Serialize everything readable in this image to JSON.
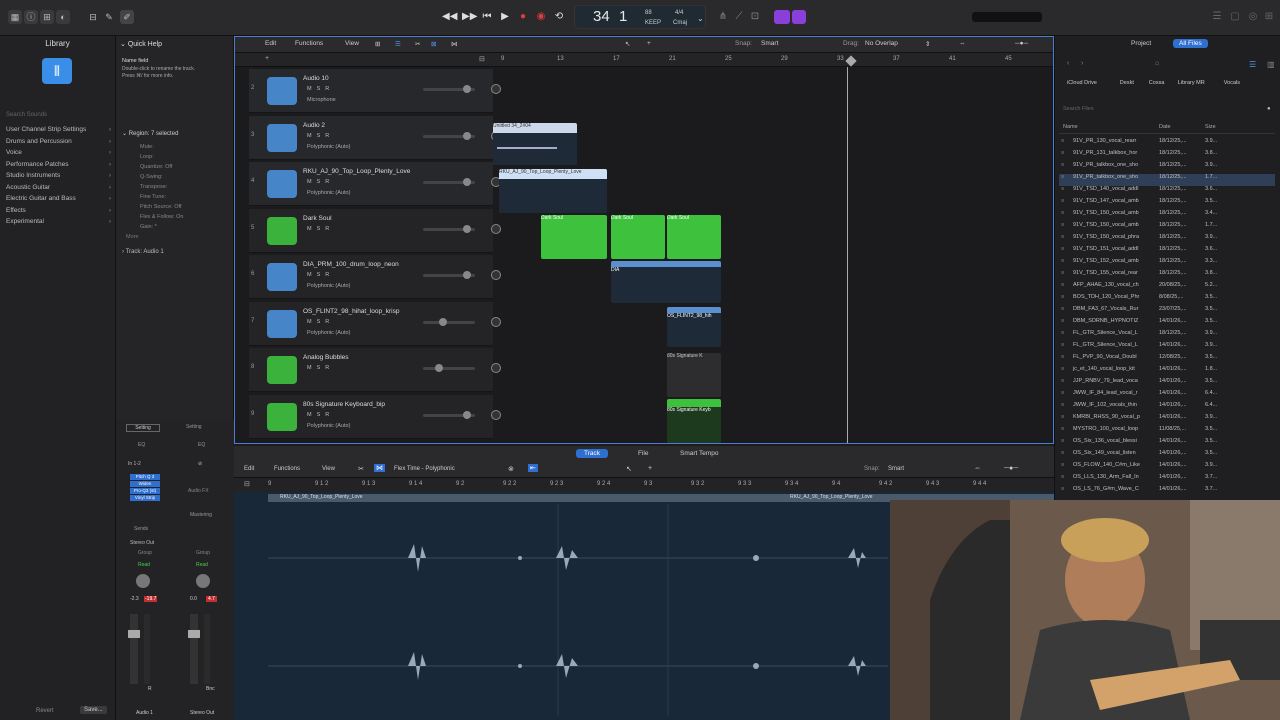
{
  "transport": {
    "position_bar": "34",
    "position_beat": "1",
    "tempo": "88",
    "tempo_label": "KEEP",
    "signature": "4/4",
    "key": "Cmaj"
  },
  "library": {
    "title": "Library",
    "search_placeholder": "Search Sounds",
    "items": [
      "User Channel Strip Settings",
      "Drums and Percussion",
      "Voice",
      "Performance Patches",
      "Studio Instruments",
      "Acoustic Guitar",
      "Electric Guitar and Bass",
      "Effects",
      "Experimental"
    ],
    "revert": "Revert",
    "save": "Save..."
  },
  "quick_help": {
    "title": "Quick Help",
    "name_field": "Name field",
    "help_text_1": "Double-click to rename the track.",
    "help_text_2": "Press ⌘/ for more info.",
    "region_label": "Region: 7 selected",
    "rows": [
      "Mute:",
      "Loop:",
      "Quantize: Off",
      "Q-Swing:",
      "Transpose:",
      "Fine Tune:",
      "Pitch Source: Off",
      "Flex & Follow: On",
      "Gain: *"
    ],
    "more": "More",
    "track_label": "Track: Audio 1"
  },
  "tracks_toolbar": {
    "edit": "Edit",
    "functions": "Functions",
    "view": "View",
    "snap_label": "Snap:",
    "snap_value": "Smart",
    "drag_label": "Drag:",
    "drag_value": "No Overlap"
  },
  "ruler": [
    "9",
    "13",
    "17",
    "21",
    "25",
    "29",
    "33",
    "37",
    "41",
    "45"
  ],
  "tracks": [
    {
      "num": "2",
      "name": "Audio 10",
      "sub": "Microphone",
      "color": "#4a90d9",
      "icon": "waveform-icon"
    },
    {
      "num": "3",
      "name": "Audio 2",
      "sub": "Polyphonic (Auto)",
      "color": "#4a90d9",
      "icon": "waveform-icon"
    },
    {
      "num": "4",
      "name": "RKU_AJ_90_Top_Loop_Plenty_Love",
      "sub": "Polyphonic (Auto)",
      "color": "#4a90d9",
      "icon": "waveform-icon"
    },
    {
      "num": "5",
      "name": "Dark Soul",
      "sub": "",
      "color": "#3ec23e",
      "icon": "guitar-icon"
    },
    {
      "num": "6",
      "name": "DIA_PRM_100_drum_loop_neon",
      "sub": "Polyphonic (Auto)",
      "color": "#4a90d9",
      "icon": "drumsticks-icon"
    },
    {
      "num": "7",
      "name": "OS_FLINT2_98_hihat_loop_krisp",
      "sub": "Polyphonic (Auto)",
      "color": "#4a90d9",
      "icon": "cymbal-icon"
    },
    {
      "num": "8",
      "name": "Analog Bubbles",
      "sub": "",
      "color": "#3ec23e",
      "icon": "synth-icon"
    },
    {
      "num": "9",
      "name": "80s Signature Keyboard_bip",
      "sub": "Polyphonic (Auto)",
      "color": "#3ec23e",
      "icon": "synth-icon"
    }
  ],
  "regions": {
    "untitled": "Untitled 34_2#04",
    "rku": "RKU_AJ_90_Top_Loop_Plenty_Love",
    "dark_soul": "Dark Soul",
    "dia": "DIA",
    "os_flint": "OS_FLINT2_98_hih",
    "sig": "80s Signature K",
    "sig2": "80s Signature Keyb"
  },
  "browser": {
    "tab_project": "Project",
    "tab_all": "All Files",
    "path": [
      "iCloud Drive",
      "Deskt",
      "Cossa",
      "Library MR",
      "Vocals"
    ],
    "search_placeholder": "Search Files",
    "col_name": "Name",
    "col_date": "Date",
    "col_size": "Size",
    "files": [
      [
        "91V_PR_130_vocal_rearr",
        "18/12/25,...",
        "3.9..."
      ],
      [
        "91V_PR_131_talkbox_hor",
        "18/12/25,...",
        "3.8..."
      ],
      [
        "91V_PR_talkbox_one_sho",
        "18/12/25,...",
        "3.9..."
      ],
      [
        "91V_PR_talkbox_one_sho",
        "18/12/25,...",
        "1.7..."
      ],
      [
        "91V_TSD_140_vocal_addl",
        "18/12/25,...",
        "3.6..."
      ],
      [
        "91V_TSD_147_vocal_amb",
        "18/12/25,...",
        "3.5..."
      ],
      [
        "91V_TSD_150_vocal_amb",
        "18/12/25,...",
        "3.4..."
      ],
      [
        "91V_TSD_150_vocal_amb",
        "18/12/25,...",
        "1.7..."
      ],
      [
        "91V_TSD_150_vocal_phra",
        "18/12/25,...",
        "3.9..."
      ],
      [
        "91V_TSD_151_vocal_addl",
        "18/12/25,...",
        "3.6..."
      ],
      [
        "91V_TSD_152_vocal_amb",
        "18/12/25,...",
        "3.3..."
      ],
      [
        "91V_TSD_155_vocal_rear",
        "18/12/25,...",
        "3.8..."
      ],
      [
        "AFP_AHAE_130_vocal_ch",
        "20/08/25,...",
        "5.2..."
      ],
      [
        "BOS_TDH_120_Vocal_Phr",
        "8/08/25,...",
        "3.5..."
      ],
      [
        "DBM_FA3_67_Vocals_Rur",
        "23/07/25,...",
        "3.5..."
      ],
      [
        "DBM_SDRNB_HYPNOTIZ",
        "14/01/26,...",
        "3.5..."
      ],
      [
        "FL_GTR_Silence_Vocal_L",
        "18/12/25,...",
        "3.9..."
      ],
      [
        "FL_GTR_Silence_Vocal_L",
        "14/01/26,...",
        "3.9..."
      ],
      [
        "FL_PVP_90_Vocal_Doubl",
        "12/08/25,...",
        "3.5..."
      ],
      [
        "jc_et_140_vocal_loop_kit",
        "14/01/26,...",
        "1.8..."
      ],
      [
        "JJP_RNBV_79_lead_voca",
        "14/01/26,...",
        "3.5..."
      ],
      [
        "JWW_IF_84_lead_vocal_r",
        "14/01/26,...",
        "6.4..."
      ],
      [
        "JWW_IF_102_vocals_thin",
        "14/01/26,...",
        "6.4..."
      ],
      [
        "KMRBI_RHSS_90_vocal_p",
        "14/01/26,...",
        "3.9..."
      ],
      [
        "MYSTRO_100_vocal_loop",
        "11/08/25,...",
        "3.5..."
      ],
      [
        "OS_Six_136_vocal_blessi",
        "14/01/26,...",
        "3.5..."
      ],
      [
        "OS_Six_149_vocal_listen",
        "14/01/26,...",
        "3.5..."
      ],
      [
        "OS_FLOW_140_C#m_Like",
        "14/01/26,...",
        "3.9..."
      ],
      [
        "OS_LLS_130_Arm_Fall_In",
        "14/01/26,...",
        "3.7..."
      ],
      [
        "OS_LS_76_G#m_Wave_C",
        "14/01/26,...",
        "3.7..."
      ]
    ]
  },
  "editor": {
    "tab_track": "Track",
    "tab_file": "File",
    "tab_smart_tempo": "Smart Tempo",
    "edit": "Edit",
    "functions": "Functions",
    "view": "View",
    "flex_mode": "Flex Time - Polyphonic",
    "snap_label": "Snap:",
    "snap_value": "Smart",
    "ruler": [
      "9",
      "9 1 2",
      "9 1 3",
      "9 1 4",
      "9 2",
      "9 2 2",
      "9 2 3",
      "9 2 4",
      "9 3",
      "9 3 2",
      "9 3 3",
      "9 3 4",
      "9 4",
      "9 4 2",
      "9 4 3",
      "9 4 4"
    ],
    "region_name": "RKU_AJ_90_Top_Loop_Plenty_Love"
  },
  "mixer": {
    "setting": "Setting",
    "eq": "EQ",
    "audio_fx": "Audio FX",
    "sends": "Sends",
    "stereo_out": "Stereo Out",
    "group": "Group",
    "read": "Read",
    "vol1": "-2.3",
    "vol1b": "-19.7",
    "vol2": "0.0",
    "vol2b": "4.7",
    "strip1_name": "Audio 1",
    "strip2_name": "Stereo Out",
    "mastering": "Mastering",
    "bnc": "Bnc",
    "input": "In 1-2",
    "plugins": [
      "Pitch Q 3",
      "Widen",
      "Pro-Q3 (st)",
      "Vinyl Strip"
    ]
  }
}
